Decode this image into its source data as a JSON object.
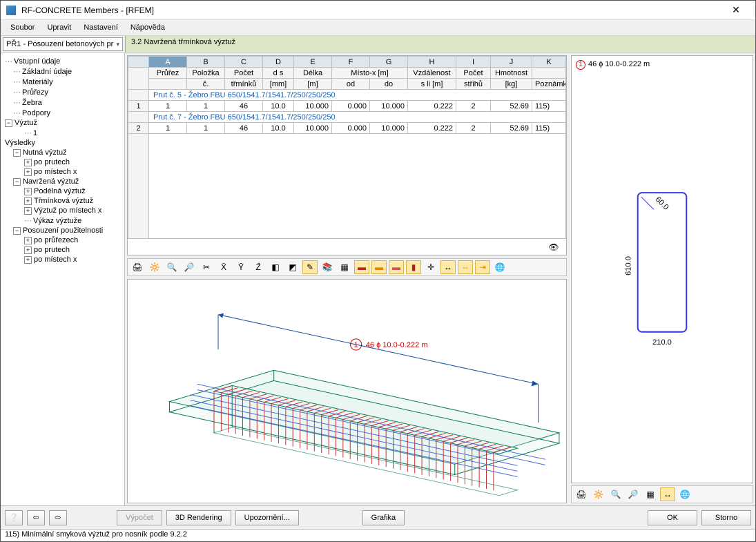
{
  "window_title": "RF-CONCRETE Members - [RFEM]",
  "menu": [
    "Soubor",
    "Upravit",
    "Nastavení",
    "Nápověda"
  ],
  "combo": "PŘ1 - Posouzení betonových pr",
  "tab_title": "3.2 Navržená třmínková výztuž",
  "cols_letters": [
    "",
    "A",
    "B",
    "C",
    "D",
    "E",
    "F",
    "G",
    "H",
    "I",
    "J",
    "K"
  ],
  "cols_row1": [
    "",
    "Průřez",
    "Položka",
    "Počet",
    "d s",
    "Délka",
    "Místo-x [m]",
    "",
    "Vzdálenost",
    "Počet",
    "Hmotnost",
    ""
  ],
  "cols_row2": [
    "",
    "",
    "č.",
    "třmínků",
    "[mm]",
    "[m]",
    "od",
    "do",
    "s li [m]",
    "střihů",
    "[kg]",
    "Poznámky"
  ],
  "group1": {
    "a": "Prut č. 5  -",
    "b": "Žebro FBU 650/1541.7/1541.7/250/250/250"
  },
  "row1": [
    "1",
    "1",
    "1",
    "46",
    "10.0",
    "10.000",
    "0.000",
    "10.000",
    "0.222",
    "2",
    "52.69",
    "115)"
  ],
  "group2": {
    "a": "Prut č. 7  -",
    "b": "Žebro FBU 650/1541.7/1541.7/250/250/250"
  },
  "row2": [
    "2",
    "1",
    "1",
    "46",
    "10.0",
    "10.000",
    "0.000",
    "10.000",
    "0.222",
    "2",
    "52.69",
    "115)"
  ],
  "nav": {
    "root1": "Vstupní údaje",
    "n1": [
      "Základní údaje",
      "Materiály",
      "Průřezy",
      "Žebra",
      "Podpory"
    ],
    "root2": "Výztuž",
    "root2_child": "1",
    "root3": "Výsledky",
    "r1": "Nutná výztuž",
    "r1c": [
      "po prutech",
      "po místech x"
    ],
    "r2": "Navržená výztuž",
    "r2c": [
      "Podélná výztuž",
      "Třmínková výztuž",
      "Výztuž po místech x",
      "Výkaz výztuže"
    ],
    "r3": "Posouzení použitelnosti",
    "r3c": [
      "po průřezech",
      "po prutech",
      "po místech x"
    ]
  },
  "cross": {
    "label": "46 ɸ 10.0-0.222 m",
    "w": "210.0",
    "h": "610.0",
    "cover": "60.0"
  },
  "render_label": "46 ɸ 10.0-0.222 m",
  "buttons": {
    "calc": "Výpočet",
    "render": "3D Rendering",
    "warn": "Upozornění...",
    "graph": "Grafika",
    "ok": "OK",
    "cancel": "Storno"
  },
  "status": "115) Minimální smyková výztuž pro nosník podle 9.2.2"
}
